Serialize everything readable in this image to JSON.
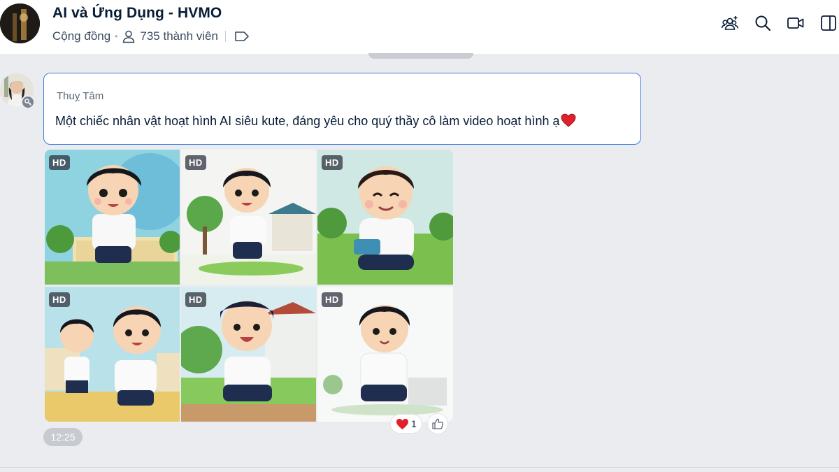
{
  "header": {
    "title": "AI và Ứng Dụng - HVMO",
    "community_label": "Cộng đồng",
    "member_count": "735 thành viên",
    "icons": [
      "group-add-icon",
      "search-icon",
      "video-call-icon",
      "sidebar-toggle-icon"
    ]
  },
  "message": {
    "sender": "Thuỵ Tâm",
    "text": "Một chiếc nhân vật hoạt hình AI siêu kute, đáng yêu cho quý thầy cô làm video hoạt hình ạ",
    "images": [
      {
        "badge": "HD"
      },
      {
        "badge": "HD"
      },
      {
        "badge": "HD"
      },
      {
        "badge": "HD"
      },
      {
        "badge": "HD"
      },
      {
        "badge": "HD"
      }
    ],
    "reaction_count": "1",
    "time": "12:25"
  },
  "colors": {
    "accent": "#3b7ee1",
    "heart": "#e0202b"
  }
}
